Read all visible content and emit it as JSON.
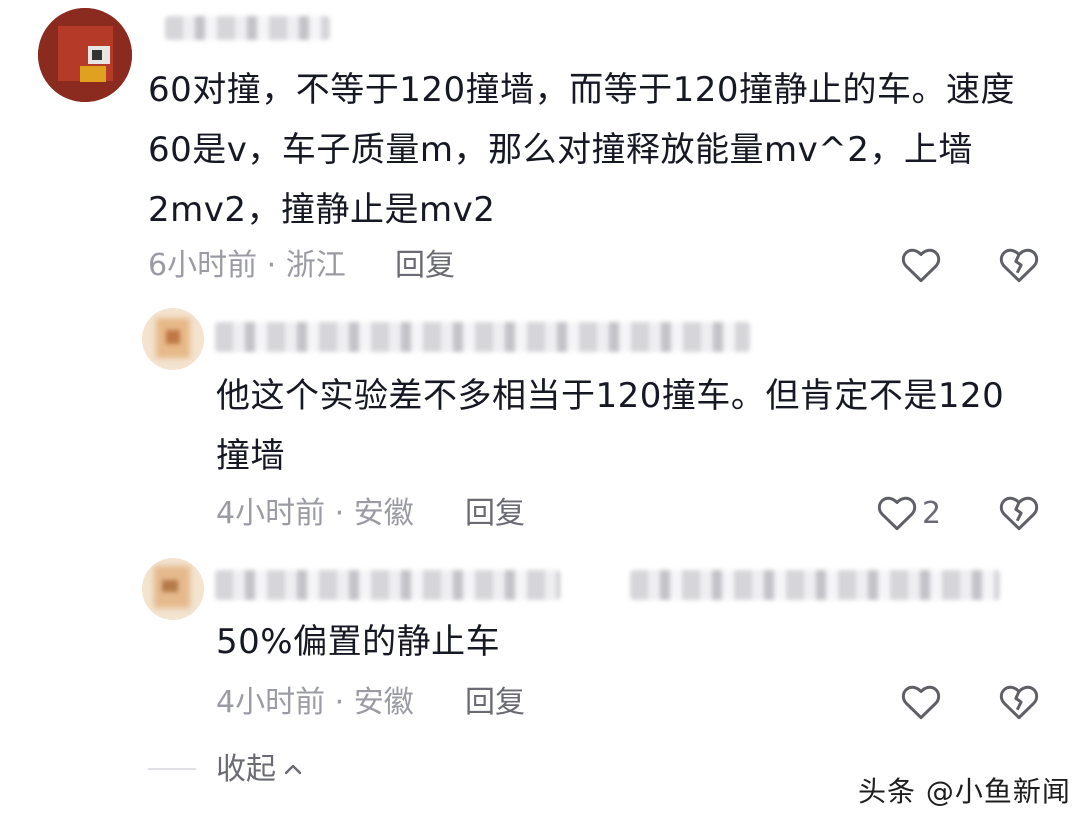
{
  "comments": [
    {
      "text_lines": [
        "60对撞，不等于120撞墙，而等于120撞静止的车。速度",
        "60是v，车子质量m，那么对撞释放能量mv^2，上墙",
        "2mv2，撞静止是mv2"
      ],
      "time_location": "6小时前 · 浙江",
      "reply_label": "回复"
    }
  ],
  "replies": [
    {
      "text_lines": [
        "他这个实验差不多相当于120撞车。但肯定不是120",
        "撞墙"
      ],
      "time_location": "4小时前 · 安徽",
      "reply_label": "回复",
      "like_count": "2"
    },
    {
      "text_lines": [
        "50%偏置的静止车"
      ],
      "time_location": "4小时前 · 安徽",
      "reply_label": "回复"
    }
  ],
  "collapse_label": "收起",
  "watermark": "头条 @小鱼新闻",
  "icons": {
    "like": "heart-outline-icon",
    "dislike": "broken-heart-icon",
    "collapse": "chevron-up-icon"
  },
  "colors": {
    "text": "#161823",
    "meta": "#9b9ca3",
    "reply": "#6b6c73",
    "icon": "#5f6066"
  }
}
